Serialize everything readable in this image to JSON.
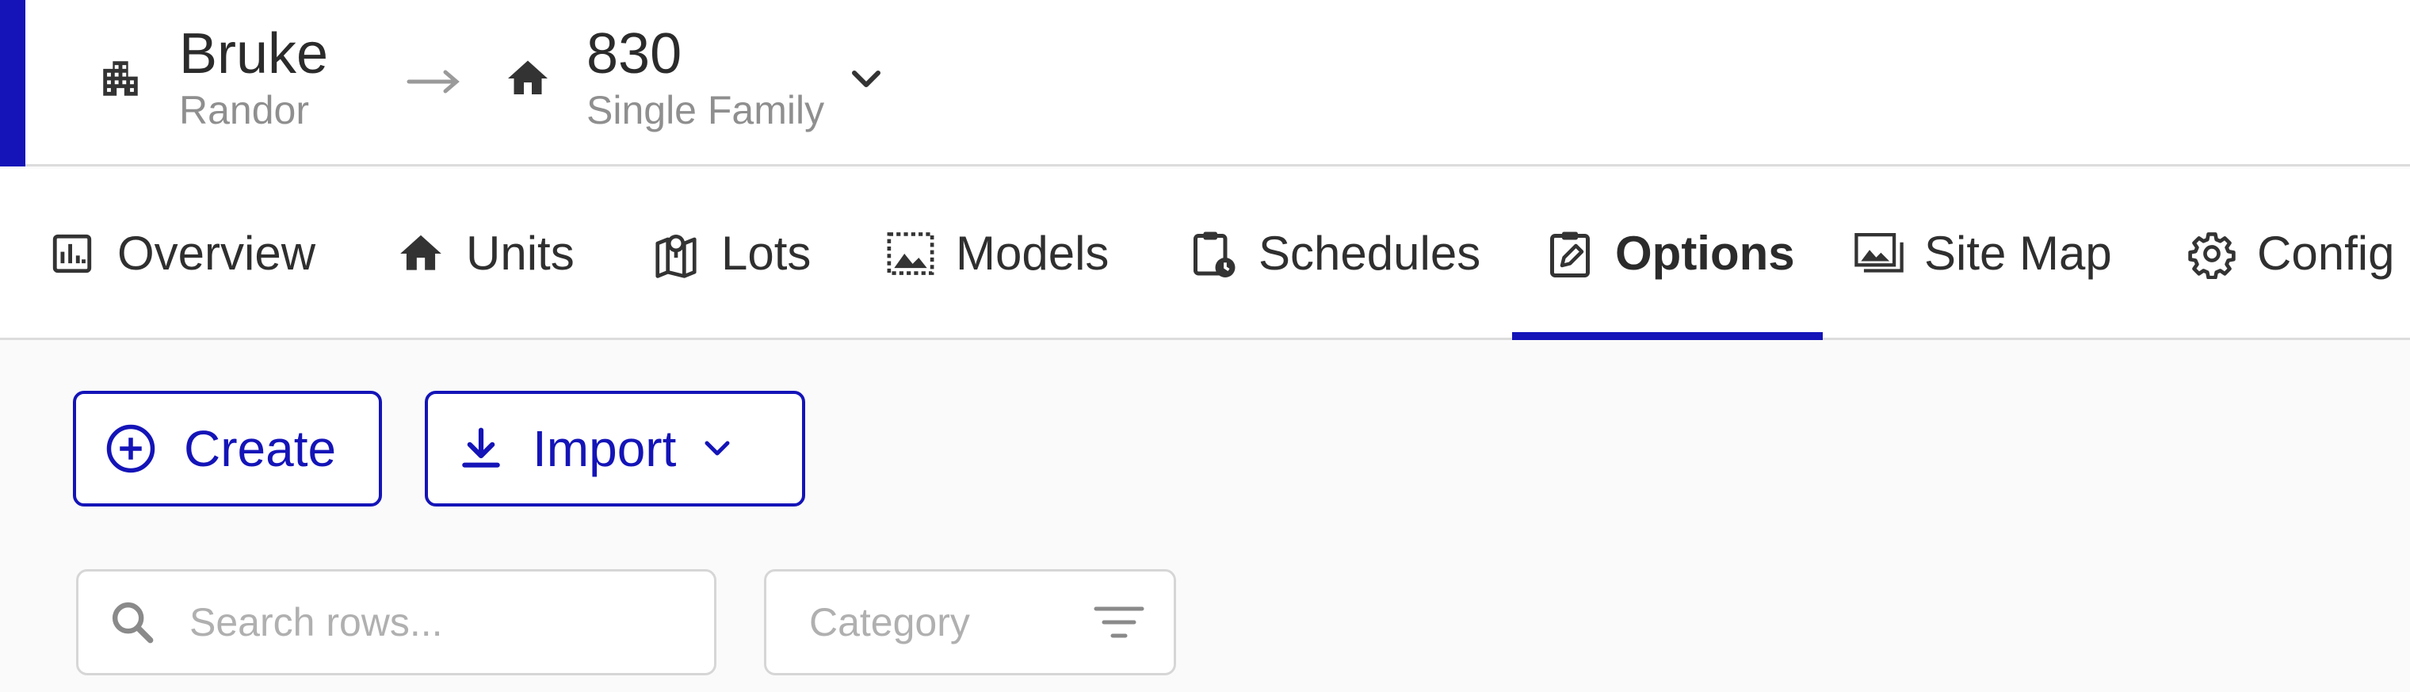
{
  "colors": {
    "accent": "#1414b8",
    "icon": "#333333"
  },
  "header": {
    "community": {
      "title": "Bruke",
      "subtitle": "Randor",
      "icon": "building-icon"
    },
    "plan": {
      "title": "830",
      "subtitle": "Single Family",
      "icon": "home-icon"
    },
    "separator_icon": "arrow-right-icon",
    "dropdown_icon": "chevron-down-icon"
  },
  "tabs": [
    {
      "label": "Overview",
      "icon": "bar-chart-icon"
    },
    {
      "label": "Units",
      "icon": "home-icon"
    },
    {
      "label": "Lots",
      "icon": "map-pin-icon"
    },
    {
      "label": "Models",
      "icon": "image-frame-icon"
    },
    {
      "label": "Schedules",
      "icon": "clipboard-clock-icon"
    },
    {
      "label": "Options",
      "icon": "clipboard-edit-icon",
      "active": true
    },
    {
      "label": "Site Map",
      "icon": "images-icon"
    },
    {
      "label": "Config",
      "icon": "gear-icon"
    }
  ],
  "actions": {
    "create_label": "Create",
    "import_label": "Import"
  },
  "search": {
    "placeholder": "Search rows..."
  },
  "category": {
    "placeholder": "Category"
  }
}
